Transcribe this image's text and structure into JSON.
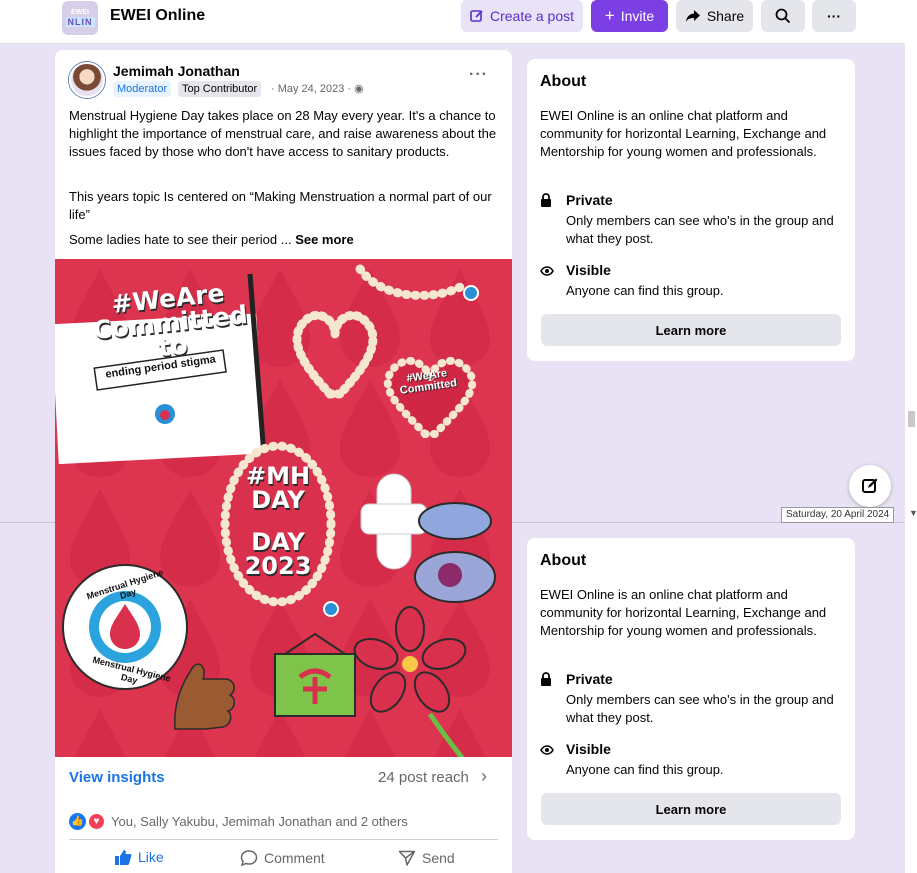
{
  "header": {
    "logo_line1": "EWEI",
    "logo_line2": "NLIN",
    "group_name": "EWEI Online",
    "create_post": "Create a post",
    "invite": "Invite",
    "share": "Share",
    "more": "···"
  },
  "post": {
    "author": "Jemimah Jonathan",
    "badge_moderator": "Moderator",
    "badge_top": "Top Contributor",
    "meta": "· May 24, 2023 · ",
    "more": "···",
    "paragraph1": "Menstrual Hygiene Day takes place on 28 May every year. It's a chance to highlight the importance of menstrual care, and raise awareness about the issues faced by those who don't have access to sanitary products.",
    "paragraph2": "This years topic Is centered on “Making Menstruation a normal part of our life”",
    "paragraph3": "Some ladies hate to see their period ... ",
    "see_more": "See more",
    "image": {
      "hashtag_line1": "#WeAre",
      "hashtag_line2": "Committed",
      "hashtag_line3": "to",
      "banner": "ending period stigma",
      "heart_line1": "#WeAre",
      "heart_line2": "Committed",
      "mh_line1": "#MH",
      "mh_line2": "DAY",
      "mh_line3": "DAY",
      "mh_line4": "2023",
      "seal_top": "Menstrual Hygiene Day",
      "seal_bottom": "Menstrual Hygiene Day"
    },
    "view_insights": "View insights",
    "post_reach": "24 post reach",
    "reactions_text": "You, Sally Yakubu, Jemimah Jonathan and 2 others",
    "like": "Like",
    "comment": "Comment",
    "send": "Send"
  },
  "about": {
    "title": "About",
    "description": "EWEI Online is an online chat platform and community for horizontal Learning, Exchange and Mentorship for young women and professionals.",
    "private_title": "Private",
    "private_sub": "Only members can see who's in the group and what they post.",
    "visible_title": "Visible",
    "visible_sub": "Anyone can find this group.",
    "learn_more": "Learn more"
  },
  "tooltip": {
    "date": "Saturday, 20 April 2024"
  },
  "colors": {
    "accent": "#7b3fe4",
    "link": "#1b74e4",
    "background_band": "#e8e2f4",
    "image_red": "#d9304d"
  }
}
